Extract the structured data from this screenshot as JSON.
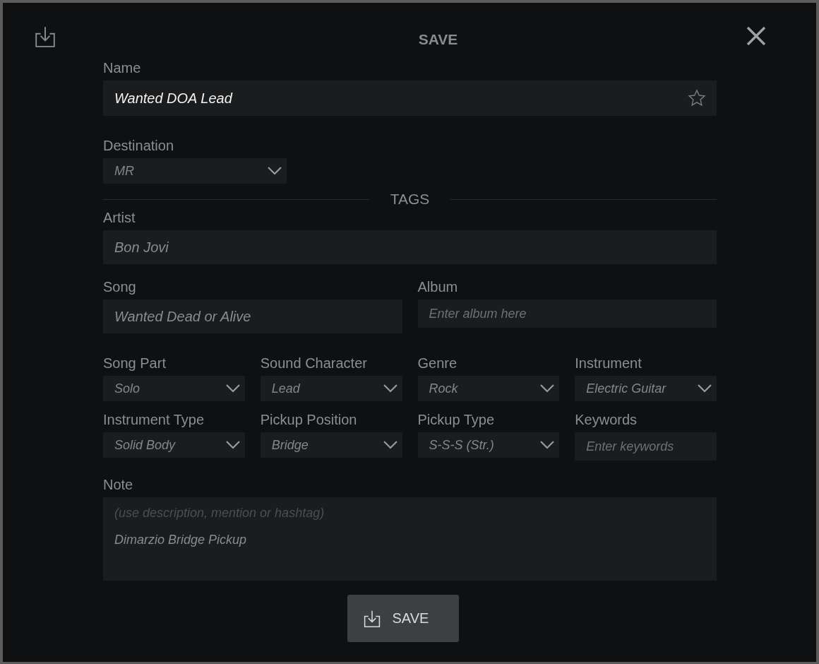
{
  "window": {
    "title": "SAVE"
  },
  "name": {
    "label": "Name",
    "value": "Wanted DOA Lead",
    "favorite": false
  },
  "destination": {
    "label": "Destination",
    "value": "MR"
  },
  "tags_heading": "TAGS",
  "artist": {
    "label": "Artist",
    "value": "Bon Jovi"
  },
  "song_row": [
    {
      "label": "Song",
      "kind": "text",
      "value": "Wanted Dead or Alive"
    },
    {
      "label": "Album",
      "kind": "text",
      "placeholder": "Enter album here"
    }
  ],
  "tag_grid": [
    {
      "label": "Song Part",
      "kind": "dropdown",
      "value": "Solo"
    },
    {
      "label": "Sound Character",
      "kind": "dropdown",
      "value": "Lead"
    },
    {
      "label": "Genre",
      "kind": "dropdown",
      "value": "Rock"
    },
    {
      "label": "Instrument",
      "kind": "dropdown",
      "value": "Electric Guitar"
    },
    {
      "label": "Instrument Type",
      "kind": "dropdown",
      "value": "Solid Body"
    },
    {
      "label": "Pickup Position",
      "kind": "dropdown",
      "value": "Bridge"
    },
    {
      "label": "Pickup Type",
      "kind": "dropdown",
      "value": "S-S-S (Str.)"
    },
    {
      "label": "Keywords",
      "kind": "text",
      "placeholder": "Enter keywords"
    }
  ],
  "note": {
    "label": "Note",
    "hint": "(use description, mention or hashtag)",
    "value": "Dimarzio Bridge Pickup"
  },
  "save_button": "SAVE"
}
